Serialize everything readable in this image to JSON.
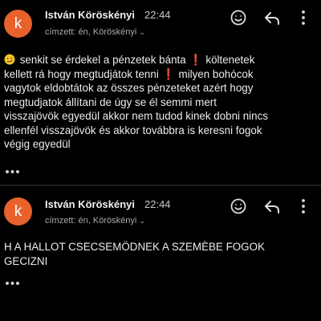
{
  "colors": {
    "background": "#000000",
    "avatar": "#e8622c",
    "text": "#ececec",
    "muted": "#aaaaaa",
    "exclamation": "#e3262a"
  },
  "emails": [
    {
      "avatar_letter": "k",
      "sender": "István Köröskényi",
      "time": "22:44",
      "recipients": "címzett: én, Köröskényi",
      "icons": [
        "emoji-reaction-icon",
        "reply-icon",
        "more-vertical-icon"
      ],
      "body_segments": [
        "senkit se érdekel a pénzetek bánta",
        "költenetek kellett rá hogy megtudjátok tenni",
        "milyen bohócok vagytok eldobtátok az összes pénzeteket azért hogy megtudjatok állítani de úgy se él semmi mert visszajövök egyedül akkor nem tudod kinek dobni nincs ellenfél visszajövök és akkor továbbra is keresni fogok végig egyedül"
      ],
      "body_lines": [
        "senkit se érdekel a pénzetek bánta ❗ költenetek",
        "kellett rá hogy megtudjátok tenni ❗ milyen bohócok",
        "vagytok eldobtátok az összes pénzeteket azért hogy",
        "megtudjatok állítani de úgy se él semmi mert",
        "visszajövök egyedül akkor nem tudod kinek dobni nincs",
        "ellenfél visszajövök és akkor továbbra is keresni fogok",
        "végig egyedül"
      ]
    },
    {
      "avatar_letter": "k",
      "sender": "István Köröskényi",
      "time": "22:44",
      "recipients": "címzett: én, Köröskényi",
      "icons": [
        "emoji-reaction-icon",
        "reply-icon",
        "more-vertical-icon"
      ],
      "body_lines": [
        "H A HALLOT CSECSEMÖDNEK A SZEMÈBE FOGOK",
        "GECIZNI"
      ]
    }
  ]
}
